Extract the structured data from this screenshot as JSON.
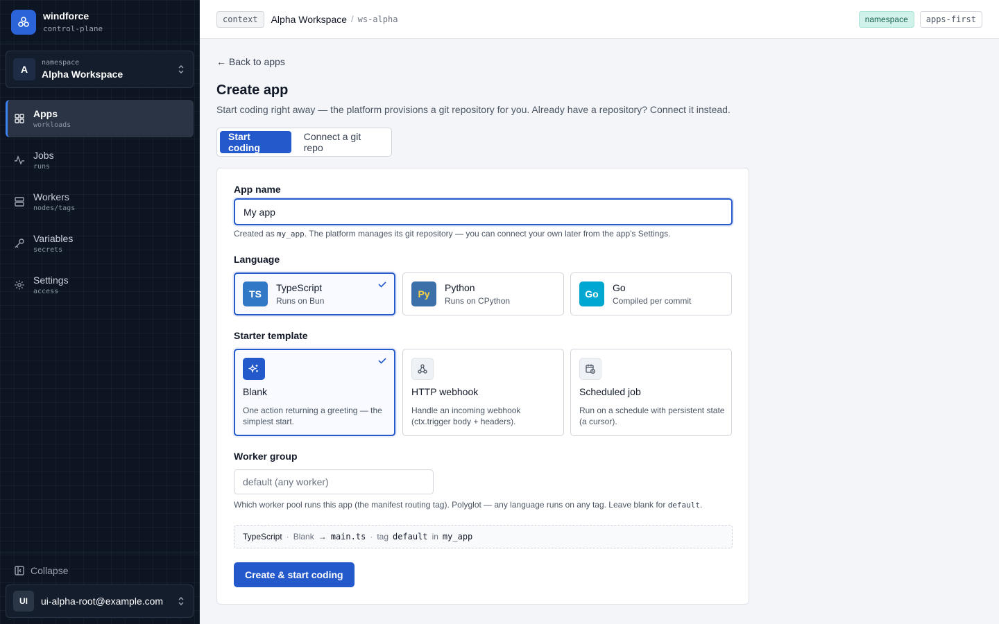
{
  "brand": {
    "name": "windforce",
    "sub": "control-plane"
  },
  "namespace_switch": {
    "avatar": "A",
    "label": "namespace",
    "value": "Alpha Workspace"
  },
  "nav": [
    {
      "title": "Apps",
      "sub": "workloads",
      "icon": "grid-icon"
    },
    {
      "title": "Jobs",
      "sub": "runs",
      "icon": "activity-icon"
    },
    {
      "title": "Workers",
      "sub": "nodes/tags",
      "icon": "server-icon"
    },
    {
      "title": "Variables",
      "sub": "secrets",
      "icon": "key-icon"
    },
    {
      "title": "Settings",
      "sub": "access",
      "icon": "gear-icon"
    }
  ],
  "sidebar_bottom": {
    "collapse": "Collapse",
    "user_avatar": "UI",
    "user_email": "ui-alpha-root@example.com"
  },
  "topbar": {
    "chip": "context",
    "title": "Alpha Workspace",
    "sep": "/",
    "id": "ws-alpha",
    "badge_ns": "namespace",
    "badge_mode": "apps-first"
  },
  "page": {
    "back": "← Back to apps",
    "title": "Create app",
    "desc": "Start coding right away — the platform provisions a git repository for you. Already have a repository? Connect it instead.",
    "tabs": [
      "Start coding",
      "Connect a git repo"
    ]
  },
  "form": {
    "app_name_label": "App name",
    "app_name_value": "My app",
    "app_name_hint_pre": "Created as ",
    "app_name_hint_code": "my_app",
    "app_name_hint_post": ". The platform manages its git repository — you can connect your own later from the app's Settings.",
    "language_label": "Language",
    "languages": [
      {
        "badge": "TS",
        "name": "TypeScript",
        "sub": "Runs on Bun",
        "color": "#3178c6",
        "text_color": "#ffffff"
      },
      {
        "badge": "Py",
        "name": "Python",
        "sub": "Runs on CPython",
        "color": "#3d6fa8",
        "text_color": "#f7d046"
      },
      {
        "badge": "Go",
        "name": "Go",
        "sub": "Compiled per commit",
        "color": "#00a7d0",
        "text_color": "#ffffff"
      }
    ],
    "template_label": "Starter template",
    "templates": [
      {
        "name": "Blank",
        "desc": "One action returning a greeting — the simplest start.",
        "icon": "sparkles-icon"
      },
      {
        "name": "HTTP webhook",
        "desc": "Handle an incoming webhook (ctx.trigger body + headers).",
        "icon": "webhook-icon"
      },
      {
        "name": "Scheduled job",
        "desc": "Run on a schedule with persistent state (a cursor).",
        "icon": "calendar-clock-icon"
      }
    ],
    "worker_group_label": "Worker group",
    "worker_group_placeholder": "default (any worker)",
    "worker_hint_pre": "Which worker pool runs this app (the manifest routing tag). Polyglot — any language runs on any tag. Leave blank for ",
    "worker_hint_code": "default",
    "worker_hint_post": ".",
    "summary": {
      "lang": "TypeScript",
      "dot": "·",
      "template": "Blank",
      "arrow": "→",
      "file": "main.ts",
      "tag_word": "tag",
      "tag": "default",
      "in_word": "in",
      "app": "my_app"
    },
    "submit": "Create & start coding"
  }
}
